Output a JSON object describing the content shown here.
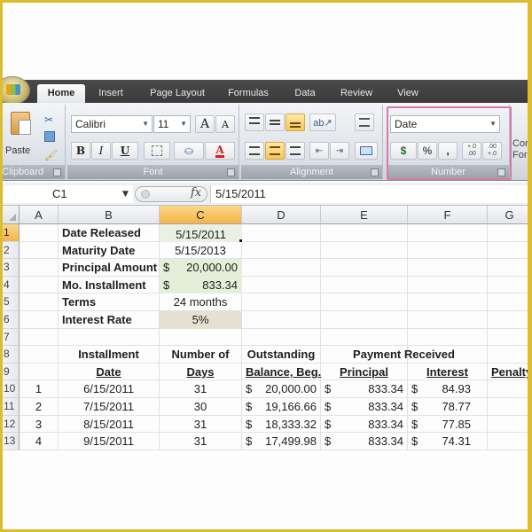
{
  "app": {
    "tabs": [
      {
        "label": "Home",
        "active": true
      },
      {
        "label": "Insert"
      },
      {
        "label": "Page Layout"
      },
      {
        "label": "Formulas"
      },
      {
        "label": "Data"
      },
      {
        "label": "Review"
      },
      {
        "label": "View"
      }
    ]
  },
  "ribbon": {
    "clipboard": {
      "label": "Clipboard",
      "paste_label": "Paste"
    },
    "font": {
      "label": "Font",
      "font_name": "Calibri",
      "font_size": "11",
      "grow_label": "A",
      "shrink_label": "A",
      "bold_label": "B",
      "italic_label": "I",
      "underline_label": "U",
      "font_color_label": "A"
    },
    "alignment": {
      "label": "Alignment"
    },
    "number": {
      "label": "Number",
      "format_value": "Date",
      "currency_label": "$",
      "percent_label": "%",
      "comma_label": ",",
      "inc_decimal_label": "+.0 .00",
      "dec_decimal_label": ".00 +.0"
    },
    "styles_partial": {
      "line1": "Cor",
      "line2": "For"
    }
  },
  "formula_bar": {
    "name_box": "C1",
    "fx_label": "fx",
    "formula": "5/15/2011"
  },
  "sheet": {
    "columns": [
      "A",
      "B",
      "C",
      "D",
      "E",
      "F",
      "G"
    ],
    "selected_column": "C",
    "selected_row": "1",
    "rows": [
      "1",
      "2",
      "3",
      "4",
      "5",
      "6",
      "7",
      "8",
      "9",
      "10",
      "11",
      "12",
      "13"
    ],
    "summary": [
      {
        "label": "Date Released",
        "value": "5/15/2011"
      },
      {
        "label": "Maturity Date",
        "value": "5/15/2013"
      },
      {
        "label": "Principal Amount",
        "currency": "$",
        "value": "20,000.00"
      },
      {
        "label": "Mo. Installment",
        "currency": "$",
        "value": "833.34"
      },
      {
        "label": "Terms",
        "value": "24 months"
      },
      {
        "label": "Interest Rate",
        "value": "5%"
      }
    ],
    "headers": {
      "installment_l1": "Installment",
      "installment_l2": "Date",
      "days_l1": "Number of",
      "days_l2": "Days",
      "balance_l1": "Outstanding",
      "balance_l2": "Balance, Beg.",
      "payment_received": "Payment Received",
      "principal": "Principal",
      "interest": "Interest",
      "penalty": "Penalty"
    },
    "schedule": [
      {
        "no": "1",
        "date": "6/15/2011",
        "days": "31",
        "balance": "20,000.00",
        "principal": "833.34",
        "interest": "84.93"
      },
      {
        "no": "2",
        "date": "7/15/2011",
        "days": "30",
        "balance": "19,166.66",
        "principal": "833.34",
        "interest": "78.77"
      },
      {
        "no": "3",
        "date": "8/15/2011",
        "days": "31",
        "balance": "18,333.32",
        "principal": "833.34",
        "interest": "77.85"
      },
      {
        "no": "4",
        "date": "9/15/2011",
        "days": "31",
        "balance": "17,499.98",
        "principal": "833.34",
        "interest": "74.31"
      }
    ],
    "currency_symbol": "$"
  }
}
